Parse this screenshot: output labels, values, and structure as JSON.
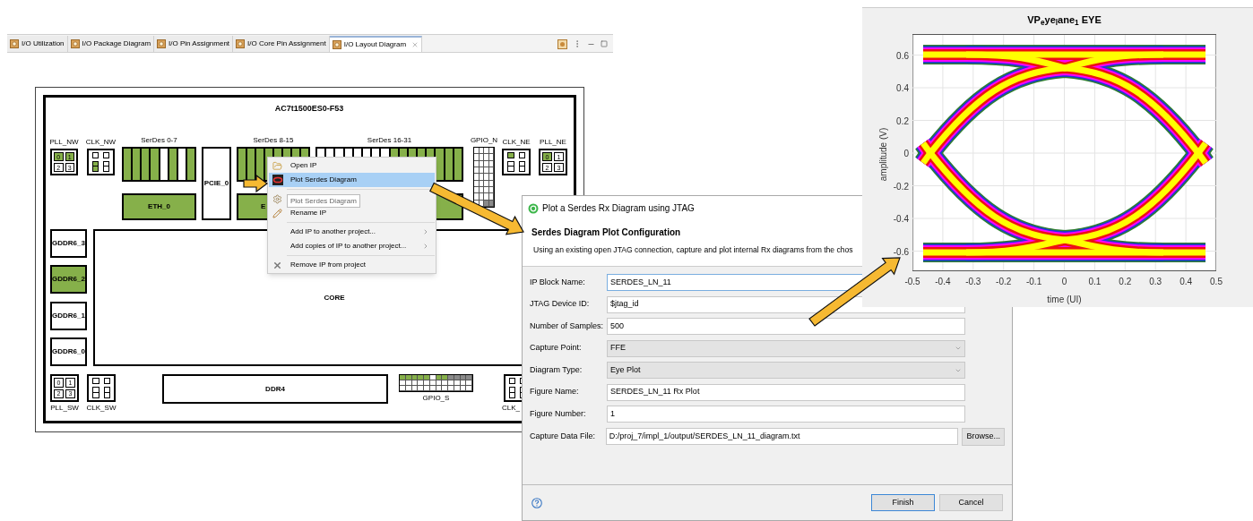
{
  "editor": {
    "tabs": [
      {
        "label": "I/O Utilization",
        "selected": false
      },
      {
        "label": "I/O Package Diagram",
        "selected": false
      },
      {
        "label": "I/O Pin Assignment",
        "selected": false
      },
      {
        "label": "I/O Core Pin Assignment",
        "selected": false
      },
      {
        "label": "I/O Layout Diagram",
        "selected": true,
        "closable": true
      }
    ],
    "diagram": {
      "title": "AC7t1500ES0-F53",
      "blocks": [
        {
          "kind": "pll",
          "label": "PLL_NW",
          "cells": [
            {
              "label": "0",
              "used": true
            },
            {
              "label": "1",
              "used": true
            },
            {
              "label": "2",
              "used": false
            },
            {
              "label": "3",
              "used": false
            }
          ]
        },
        {
          "kind": "clk",
          "label": "CLK_NW",
          "cells": [
            {
              "used": false
            },
            {
              "used": false
            },
            {
              "used": true
            },
            {
              "used": false
            }
          ]
        },
        {
          "kind": "serdes",
          "label": "SerDes 0-7",
          "lanes": [
            {
              "used": true
            },
            {
              "used": true
            },
            {
              "used": true
            },
            {
              "used": true
            },
            {
              "used": false
            },
            {
              "used": true
            },
            {
              "used": false
            },
            {
              "used": true
            }
          ]
        },
        {
          "kind": "block",
          "label": "ETH_0",
          "used": true
        },
        {
          "kind": "block",
          "label": "PCIE_0",
          "used": false
        },
        {
          "kind": "serdes",
          "label": "SerDes 8-15",
          "lanes": [
            {
              "used": true
            },
            {
              "used": true
            },
            {
              "used": true
            },
            {
              "used": true
            },
            {
              "used": true
            },
            {
              "used": true
            },
            {
              "used": true
            },
            {
              "used": true
            }
          ]
        },
        {
          "kind": "block",
          "label": "E",
          "used": true
        },
        {
          "kind": "serdes",
          "label": "SerDes 16-31",
          "lanes": [
            {
              "used": false
            },
            {
              "used": false
            },
            {
              "used": false
            },
            {
              "used": false
            },
            {
              "used": false
            },
            {
              "used": false
            },
            {
              "used": false
            },
            {
              "used": false
            },
            {
              "used": true
            },
            {
              "used": true
            },
            {
              "used": true
            },
            {
              "used": true
            },
            {
              "used": true
            },
            {
              "used": true
            },
            {
              "used": true
            },
            {
              "used": true
            }
          ]
        },
        {
          "kind": "block",
          "used": true
        },
        {
          "kind": "gpio",
          "label": "GPIO_N",
          "pins": [
            {
              "color": "#ffffff"
            },
            {
              "color": "#ffffff"
            },
            {
              "color": "#8a8a8a"
            },
            {
              "color": "#8a8a8a"
            }
          ]
        },
        {
          "kind": "clk",
          "label": "CLK_NE",
          "cells": [
            {
              "used": true
            },
            {
              "used": false
            },
            {
              "used": false
            },
            {
              "used": false
            }
          ]
        },
        {
          "kind": "pll",
          "label": "PLL_NE",
          "cells": [
            {
              "label": "0",
              "used": true
            },
            {
              "label": "1",
              "used": false
            },
            {
              "label": "2",
              "used": false
            },
            {
              "label": "3",
              "used": false
            }
          ]
        },
        {
          "kind": "block",
          "label": "GDDR6_3",
          "used": false
        },
        {
          "kind": "block",
          "label": "GDDR6_2",
          "used": true
        },
        {
          "kind": "block",
          "label": "GDDR6_1",
          "used": false
        },
        {
          "kind": "block",
          "label": "GDDR6_0",
          "used": false
        },
        {
          "kind": "block",
          "label": "CORE",
          "used": false
        },
        {
          "kind": "pll",
          "label": "PLL_SW",
          "cells": [
            {
              "label": "0",
              "used": false
            },
            {
              "label": "1",
              "used": false
            },
            {
              "label": "2",
              "used": false
            },
            {
              "label": "3",
              "used": false
            }
          ]
        },
        {
          "kind": "clk",
          "label": "CLK_SW",
          "cells": [
            {
              "used": false
            },
            {
              "used": false
            },
            {
              "used": false
            },
            {
              "used": false
            }
          ]
        },
        {
          "kind": "block",
          "label": "DDR4",
          "used": false
        },
        {
          "kind": "gpio",
          "label": "GPIO_S",
          "pins": [
            {
              "color": "#86b04a"
            },
            {
              "color": "#86b04a"
            },
            {
              "color": "#86b04a"
            },
            {
              "color": "#86b04a"
            },
            {
              "color": "#86b04a"
            },
            {
              "color": "#ffffff"
            },
            {
              "color": "#86b04a"
            },
            {
              "color": "#86b04a"
            },
            {
              "color": "#8a8a8a"
            },
            {
              "color": "#8a8a8a"
            },
            {
              "color": "#8a8a8a"
            },
            {
              "color": "#8a8a8a"
            }
          ]
        },
        {
          "kind": "clk",
          "label": "CLK_",
          "cells": [
            {
              "used": false
            },
            {
              "used": false
            },
            {
              "used": false
            },
            {
              "used": false
            }
          ]
        }
      ]
    }
  },
  "context_menu": {
    "items": [
      {
        "kind": "item",
        "label": "Open IP",
        "selected": false
      },
      {
        "kind": "item",
        "label": "Plot Serdes Diagram",
        "selected": true
      },
      {
        "kind": "separator"
      },
      {
        "kind": "item",
        "selected": false
      },
      {
        "kind": "item",
        "label": "Rename IP",
        "selected": false
      },
      {
        "kind": "separator"
      },
      {
        "kind": "submenu",
        "label": "Add IP to another project...",
        "selected": false
      },
      {
        "kind": "submenu",
        "label": "Add copies of IP to another project...",
        "selected": false
      },
      {
        "kind": "separator"
      },
      {
        "kind": "item",
        "label": "Remove IP from project",
        "selected": false
      }
    ],
    "tooltip": "Plot Serdes Diagram"
  },
  "dialog": {
    "title": "Plot a Serdes Rx Diagram using JTAG",
    "heading": "Serdes Diagram Plot Configuration",
    "description": "Using an existing open JTAG connection, capture and plot internal Rx diagrams from the chos",
    "fields": [
      {
        "label": "IP Block Name:",
        "kind": "text",
        "value": "SERDES_LN_11",
        "focused": true
      },
      {
        "label": "JTAG Device ID:",
        "kind": "text",
        "value": "$jtag_id",
        "focused": false
      },
      {
        "label": "Number of Samples:",
        "kind": "text",
        "value": "500",
        "focused": false
      },
      {
        "label": "Capture Point:",
        "kind": "select",
        "value": "FFE",
        "focused": false
      },
      {
        "label": "Diagram Type:",
        "kind": "select",
        "value": "Eye Plot",
        "focused": false
      },
      {
        "label": "Figure Name:",
        "kind": "text",
        "value": "SERDES_LN_11 Rx Plot",
        "focused": false
      },
      {
        "label": "Figure Number:",
        "kind": "text",
        "value": "1",
        "focused": false
      },
      {
        "label": "Capture Data File:",
        "kind": "file",
        "value": "D:/proj_7/impl_1/output/SERDES_LN_11_diagram.txt",
        "focused": false,
        "button": "Browse..."
      }
    ],
    "buttons": [
      {
        "label": "Finish",
        "default": true
      },
      {
        "label": "Cancel",
        "default": false
      }
    ]
  },
  "plot": {
    "title": "VP$_{e}$ye$_{l}$ane$_{1}$ EYE",
    "xlabel": "time (UI)",
    "ylabel": "amplitude (V)",
    "xticks": [
      "-0.5",
      "-0.4",
      "-0.3",
      "-0.2",
      "-0.1",
      "0",
      "0.1",
      "0.2",
      "0.3",
      "0.4",
      "0.5"
    ],
    "yticks": [
      "0.6",
      "0.4",
      "0.2",
      "0",
      "-0.2",
      "-0.4",
      "-0.6"
    ]
  }
}
